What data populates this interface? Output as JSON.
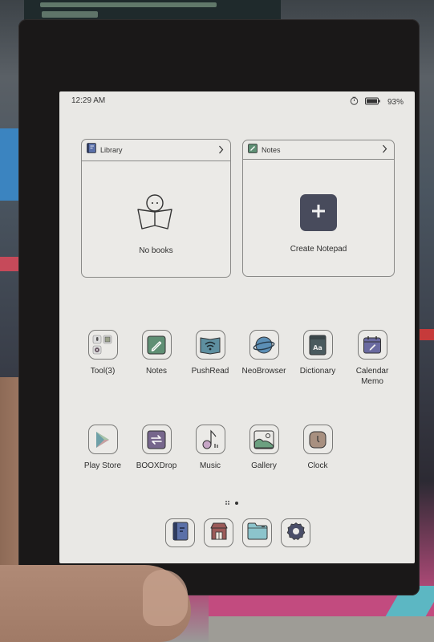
{
  "status_bar": {
    "time": "12:29 AM",
    "battery_percent": "93%",
    "battery_level": 0.93,
    "icons": [
      "timer-icon",
      "battery-icon"
    ]
  },
  "widgets": {
    "library": {
      "title": "Library",
      "icon": "book-icon",
      "empty_text": "No books",
      "empty_icon": "reader-with-book-icon"
    },
    "notes": {
      "title": "Notes",
      "icon": "pencil-icon",
      "action_label": "Create Notepad",
      "action_icon": "plus-icon"
    }
  },
  "apps": [
    {
      "label": "Tool(3)",
      "icon": "tools-folder-icon"
    },
    {
      "label": "Notes",
      "icon": "notes-pencil-icon"
    },
    {
      "label": "PushRead",
      "icon": "pushread-wifi-book-icon"
    },
    {
      "label": "NeoBrowser",
      "icon": "planet-browser-icon"
    },
    {
      "label": "Dictionary",
      "icon": "dictionary-book-icon"
    },
    {
      "label": "Calendar Memo",
      "icon": "calendar-memo-icon"
    },
    {
      "label": "Play Store",
      "icon": "play-store-icon"
    },
    {
      "label": "BOOXDrop",
      "icon": "transfer-arrows-icon"
    },
    {
      "label": "Music",
      "icon": "music-note-icon"
    },
    {
      "label": "Gallery",
      "icon": "gallery-image-icon"
    },
    {
      "label": "Clock",
      "icon": "clock-icon"
    }
  ],
  "page_indicator": {
    "pages": 1,
    "current": 1
  },
  "dock": [
    {
      "name": "library",
      "icon": "library-book-icon"
    },
    {
      "name": "store",
      "icon": "store-icon"
    },
    {
      "name": "storage",
      "icon": "folder-icon"
    },
    {
      "name": "settings",
      "icon": "settings-gear-icon"
    }
  ],
  "colors": {
    "screen_bg": "#e9e8e5",
    "library_blue": "#5b70a8",
    "notes_green": "#5f8f74",
    "pushread_teal": "#5e8fa0",
    "browser_blue": "#5c8fb6",
    "dictionary_dark": "#4a5a5e",
    "calendar_purple": "#6a6aa0",
    "boox_drop_purple": "#76668c",
    "music_pink": "#c6a6c6",
    "gallery_green": "#6ca080",
    "clock_tan": "#a89080",
    "store_red": "#9c5a58",
    "folder_teal": "#8cc4cc",
    "settings_navy": "#4a4e68",
    "plus_box": "#484b5c"
  }
}
